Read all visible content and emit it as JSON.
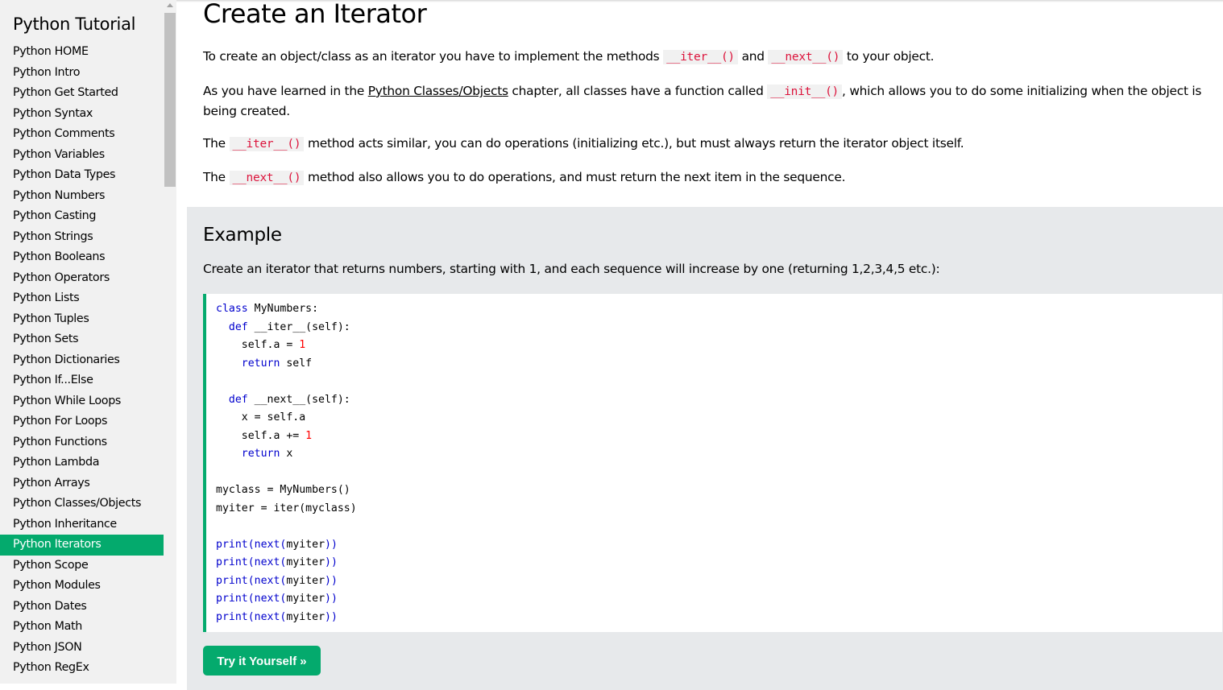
{
  "sidebar": {
    "title": "Python Tutorial",
    "items": [
      "Python HOME",
      "Python Intro",
      "Python Get Started",
      "Python Syntax",
      "Python Comments",
      "Python Variables",
      "Python Data Types",
      "Python Numbers",
      "Python Casting",
      "Python Strings",
      "Python Booleans",
      "Python Operators",
      "Python Lists",
      "Python Tuples",
      "Python Sets",
      "Python Dictionaries",
      "Python If...Else",
      "Python While Loops",
      "Python For Loops",
      "Python Functions",
      "Python Lambda",
      "Python Arrays",
      "Python Classes/Objects",
      "Python Inheritance",
      "Python Iterators",
      "Python Scope",
      "Python Modules",
      "Python Dates",
      "Python Math",
      "Python JSON",
      "Python RegEx"
    ],
    "active_item": "Python Iterators"
  },
  "main": {
    "title": "Create an Iterator",
    "p1": {
      "before": "To create an object/class as an iterator you have to implement the methods ",
      "code1": "__iter__()",
      "mid": " and ",
      "code2": "__next__()",
      "after": " to your object."
    },
    "p2": {
      "before": "As you have learned in the ",
      "link": "Python Classes/Objects",
      "mid": " chapter, all classes have a function called ",
      "code": "__init__()",
      "after": ", which allows you to do some initializing when the object is being created."
    },
    "p3": {
      "before": "The ",
      "code": "__iter__()",
      "after": " method acts similar, you can do operations (initializing etc.), but must always return the iterator object itself."
    },
    "p4": {
      "before": "The ",
      "code": "__next__()",
      "after": " method also allows you to do operations, and must return the next item in the sequence."
    }
  },
  "example": {
    "heading": "Example",
    "description": "Create an iterator that returns numbers, starting with 1, and each sequence will increase by one (returning 1,2,3,4,5 etc.):",
    "try_button": "Try it Yourself »",
    "code": {
      "l1_kw": "class",
      "l1_rest": " MyNumbers:",
      "l2_kw": "def",
      "l2_rest": " __iter__(self):",
      "l3_pre": "self.a = ",
      "l3_num": "1",
      "l4_kw": "return",
      "l4_rest": " self",
      "l6_kw": "def",
      "l6_rest": " __next__(self):",
      "l7": "x = self.a",
      "l8_pre": "self.a += ",
      "l8_num": "1",
      "l9_kw": "return",
      "l9_rest": " x",
      "l11": "myclass = MyNumbers()",
      "l12": "myiter = iter(myclass)",
      "print_kw": "print",
      "next_kw": "next",
      "print_arg": "myiter"
    }
  },
  "colors": {
    "accent": "#04aa6d",
    "code_red": "#dc143c",
    "keyword": "mediumblue",
    "number": "red",
    "example_bg": "#e7e9eb",
    "sidebar_bg": "#f1f1f1"
  }
}
